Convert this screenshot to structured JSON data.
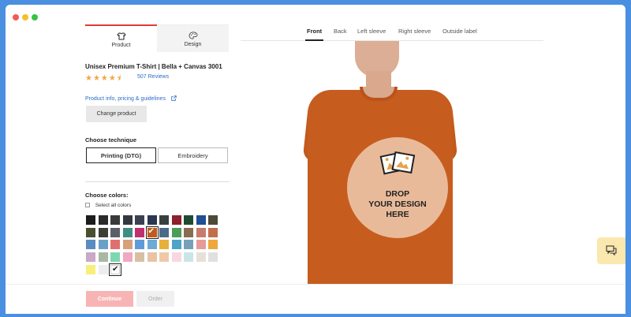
{
  "tabs": [
    {
      "label": "Product",
      "icon": "tshirt-icon"
    },
    {
      "label": "Design",
      "icon": "palette-icon"
    }
  ],
  "product": {
    "title": "Unisex Premium T-Shirt | Bella + Canvas 3001",
    "rating_stars": "★★★★⯨",
    "rating": 4.5,
    "reviews": "507 Reviews",
    "info_link": "Product info, pricing & guidelines",
    "change_button": "Change product"
  },
  "technique": {
    "label": "Choose technique",
    "options": [
      "Printing (DTG)",
      "Embroidery"
    ],
    "selected": "Printing (DTG)"
  },
  "colors": {
    "label": "Choose colors:",
    "select_all": "Select all colors",
    "swatches": [
      "#1c1c1c",
      "#2a2a2a",
      "#3a3a3a",
      "#333840",
      "#3b4150",
      "#2c3752",
      "#38403e",
      "#8e1f2c",
      "#1f4a32",
      "#1f4f94",
      "#4d4a38",
      "#4a4f32",
      "#3e3e36",
      "#5b6066",
      "#3e8e86",
      "#c22f6e",
      "#c15a1c",
      "#4b6a8a",
      "#4b9d58",
      "#8a6c54",
      "#c87a6e",
      "#c26e4c",
      "#5a8bc2",
      "#6aa0c8",
      "#e07070",
      "#d7a07a",
      "#5f9bd8",
      "#6eaad6",
      "#e8b03a",
      "#4fa3c9",
      "#76a0b8",
      "#e69a9a",
      "#eea83c",
      "#c9a8c8",
      "#a8b8a4",
      "#7dd8b0",
      "#f1a8c0",
      "#d6c0a4",
      "#e8c3a6",
      "#f0c8a8",
      "#f8d8e0",
      "#c8e6e8",
      "#e8e0d8",
      "#e0e0e0",
      "#f7ef7a",
      "#ededed",
      "#ffffff"
    ],
    "selected_indices": [
      16,
      46
    ]
  },
  "footer": {
    "continue": "Continue",
    "order": "Order"
  },
  "views": {
    "tabs": [
      "Front",
      "Back",
      "Left sleeve",
      "Right sleeve",
      "Outside label"
    ],
    "active": "Front"
  },
  "mockup": {
    "drop_text": [
      "DROP",
      "YOUR DESIGN",
      "HERE"
    ],
    "shirt_color": "#c65d1f"
  },
  "chat": {
    "icon": "chat-icon"
  }
}
